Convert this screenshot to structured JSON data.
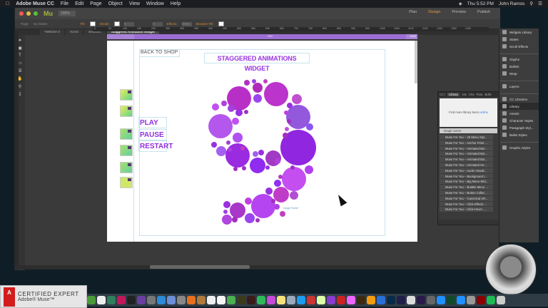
{
  "menubar": {
    "app": "Adobe Muse CC",
    "items": [
      "File",
      "Edit",
      "Page",
      "Object",
      "View",
      "Window",
      "Help"
    ],
    "clock": "Thu 5:52 PM",
    "user": "John Ramos"
  },
  "app": {
    "logo": "Mu",
    "zoom": "100%",
    "modes": [
      "Plan",
      "Design",
      "Preview",
      "Publish"
    ],
    "active_mode": "Design"
  },
  "controlbar": {
    "page_label": "Page:",
    "page_state": "No States",
    "fill": "Fill:",
    "stroke": "Stroke:",
    "stroke_value": "0",
    "size_value": "0",
    "effects": "Effects:",
    "opacity": "100%",
    "browser_fill": "Browser Fill:"
  },
  "tabs": [
    "*Website-3",
    "Home",
    "website2",
    "Staggered Animation Widget"
  ],
  "ruler": [
    "0",
    "50",
    "100",
    "150",
    "200",
    "250",
    "300",
    "350",
    "400",
    "450",
    "500",
    "550",
    "600",
    "650",
    "700",
    "750",
    "800",
    "850",
    "900",
    "950",
    "1000",
    "1050",
    "1100",
    "1150",
    "1200",
    "1250",
    "1300"
  ],
  "page_width_label": "960",
  "page_right_label": "1160",
  "page": {
    "back": "BACK TO SHOP",
    "title": "STAGGERED ANIMATIONS WIDGET",
    "controls": [
      "PLAY",
      "PAUSE",
      "RESTART"
    ],
    "image_frame": "Image Frame"
  },
  "right_panel": {
    "items": [
      "Widgets Library",
      "States",
      "Scroll Effects",
      "Glyphs",
      "Bullets",
      "Wrap",
      "Layers",
      "CC Libraries",
      "Library",
      "Assets",
      "Character Styles",
      "Paragraph Styl...",
      "Bullet Styles",
      "Graphic Styles"
    ],
    "active": "Library"
  },
  "library": {
    "tabs": [
      "CC l",
      "Library",
      "Ass",
      "Cha",
      "Para",
      "Bulle"
    ],
    "info": "Find more library items",
    "info_link": "online",
    "search": "image cursor",
    "items": [
      "Muse For You – 26 Menu Styl...",
      "Muse For You – Anchor Point ...",
      "Muse For You – Animated Bor...",
      "Muse For You – Animated Bor...",
      "Muse For You – Animated But...",
      "Muse For You – Animated He...",
      "Muse For You – Audio Visuali...",
      "Muse For You – Background I...",
      "Muse For You – Big Menu Wid...",
      "Muse For You – Bubble Menu ...",
      "Muse For You – Button Collec...",
      "Muse For You – Canonical UR...",
      "Muse For You – Click Effects ...",
      "Muse For You – Click-Hover ..."
    ]
  },
  "badge": {
    "line1": "CERTIFIED EXPERT",
    "line2": "Adobe® Muse™",
    "logo": "Adobe"
  },
  "colors": {
    "accent": "#9b35e0",
    "pagebar": "#a983d8",
    "mode_active": "#e49a3c"
  }
}
